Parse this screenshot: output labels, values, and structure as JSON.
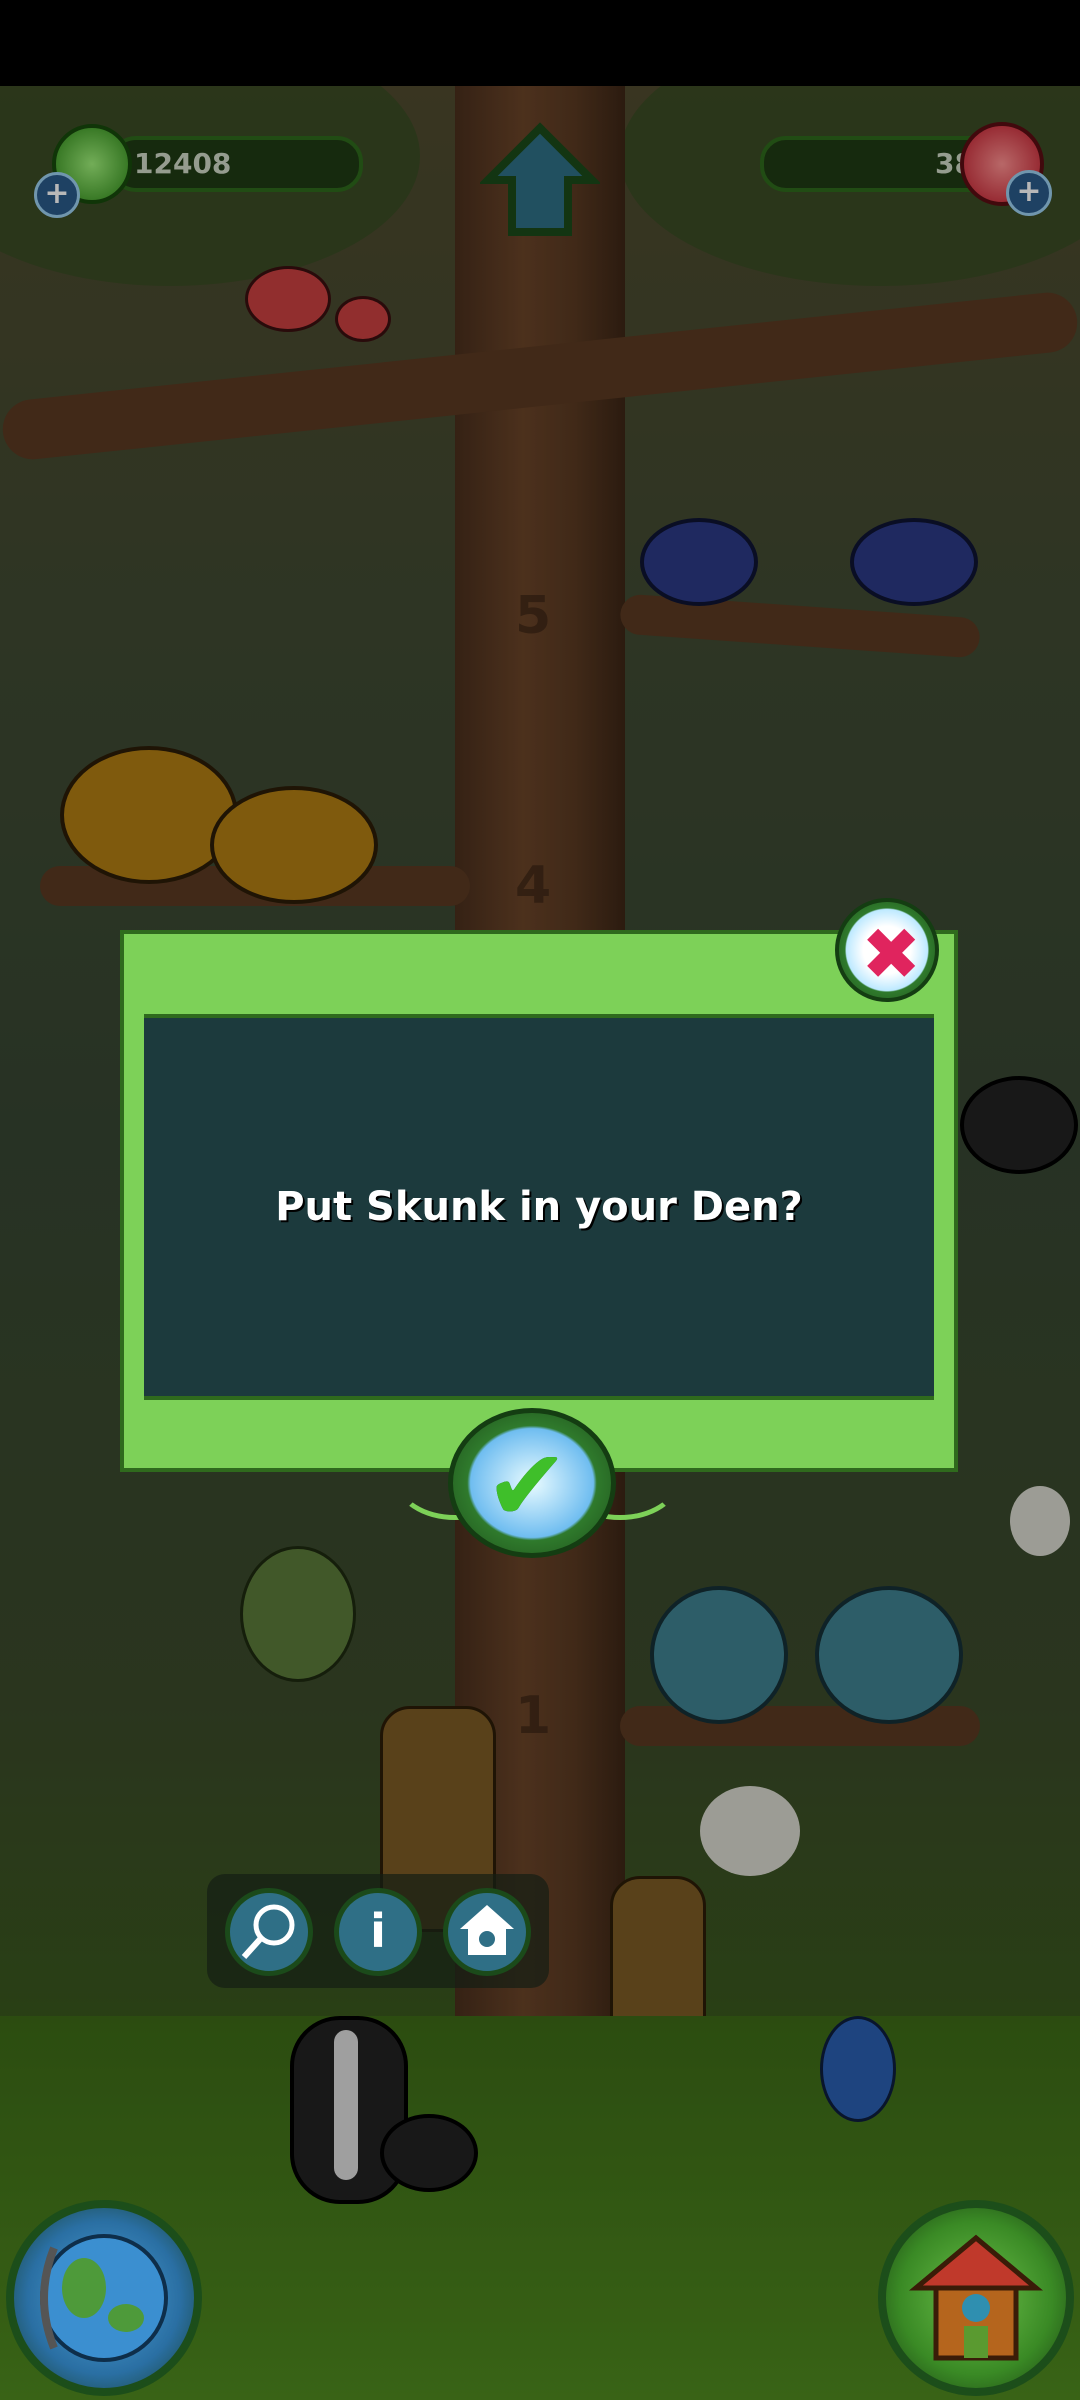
{
  "hud": {
    "nuts_count": "12408",
    "gems_count": "38",
    "plus_symbol": "+"
  },
  "scene": {
    "trunk_numbers": [
      "5",
      "4",
      "1"
    ]
  },
  "dialog": {
    "message": "Put Skunk in your Den?",
    "close_symbol": "✖",
    "confirm_symbol": "✔"
  },
  "action_bar": {
    "info_symbol": "i"
  },
  "colors": {
    "dialog_frame": "#7dd158",
    "dialog_panel": "#1c3a3d",
    "close_accent": "#e0245e",
    "confirm_accent": "#3fbf2a"
  },
  "icons": {
    "nuts": "green-acorn-icon",
    "gems": "red-crystal-icon",
    "home": "home-arrow-icon",
    "close": "close-x-icon",
    "confirm": "checkmark-icon",
    "net": "net-icon",
    "info": "info-icon",
    "den": "den-house-icon",
    "globe": "globe-icon",
    "house": "treehouse-icon"
  }
}
